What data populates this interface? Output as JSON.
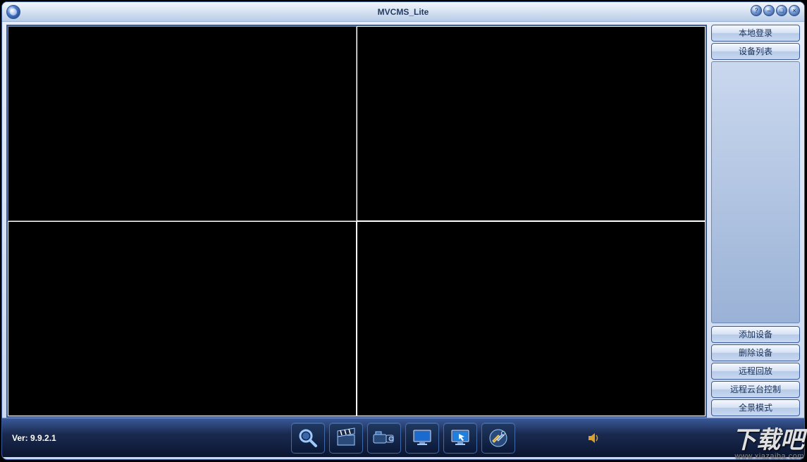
{
  "app": {
    "title": "MVCMS_Lite"
  },
  "titlebar_icons": {
    "help": "help-icon",
    "min": "minimize-icon",
    "max": "maximize-icon",
    "close": "close-icon"
  },
  "sidebar": {
    "top_buttons": [
      {
        "label": "本地登录"
      },
      {
        "label": "设备列表"
      }
    ],
    "bottom_buttons": [
      {
        "label": "添加设备"
      },
      {
        "label": "删除设备"
      },
      {
        "label": "远程回放"
      },
      {
        "label": "远程云台控制"
      },
      {
        "label": "全景模式"
      }
    ]
  },
  "footer": {
    "version_prefix": "Ver: ",
    "version": "9.9.2.1"
  },
  "toolbar": {
    "items": [
      {
        "name": "search-tool",
        "icon": "magnifier-icon"
      },
      {
        "name": "record-tool",
        "icon": "clapperboard-icon"
      },
      {
        "name": "camera-tool",
        "icon": "camcorder-icon"
      },
      {
        "name": "display-tool",
        "icon": "monitor-icon"
      },
      {
        "name": "capture-tool",
        "icon": "screen-arrow-icon"
      },
      {
        "name": "settings-tool",
        "icon": "tools-icon"
      }
    ]
  },
  "watermark": {
    "text": "下载吧",
    "url": "www.xiazaiba.com"
  },
  "grid": {
    "layout": "2x2",
    "selected_index": 0
  }
}
